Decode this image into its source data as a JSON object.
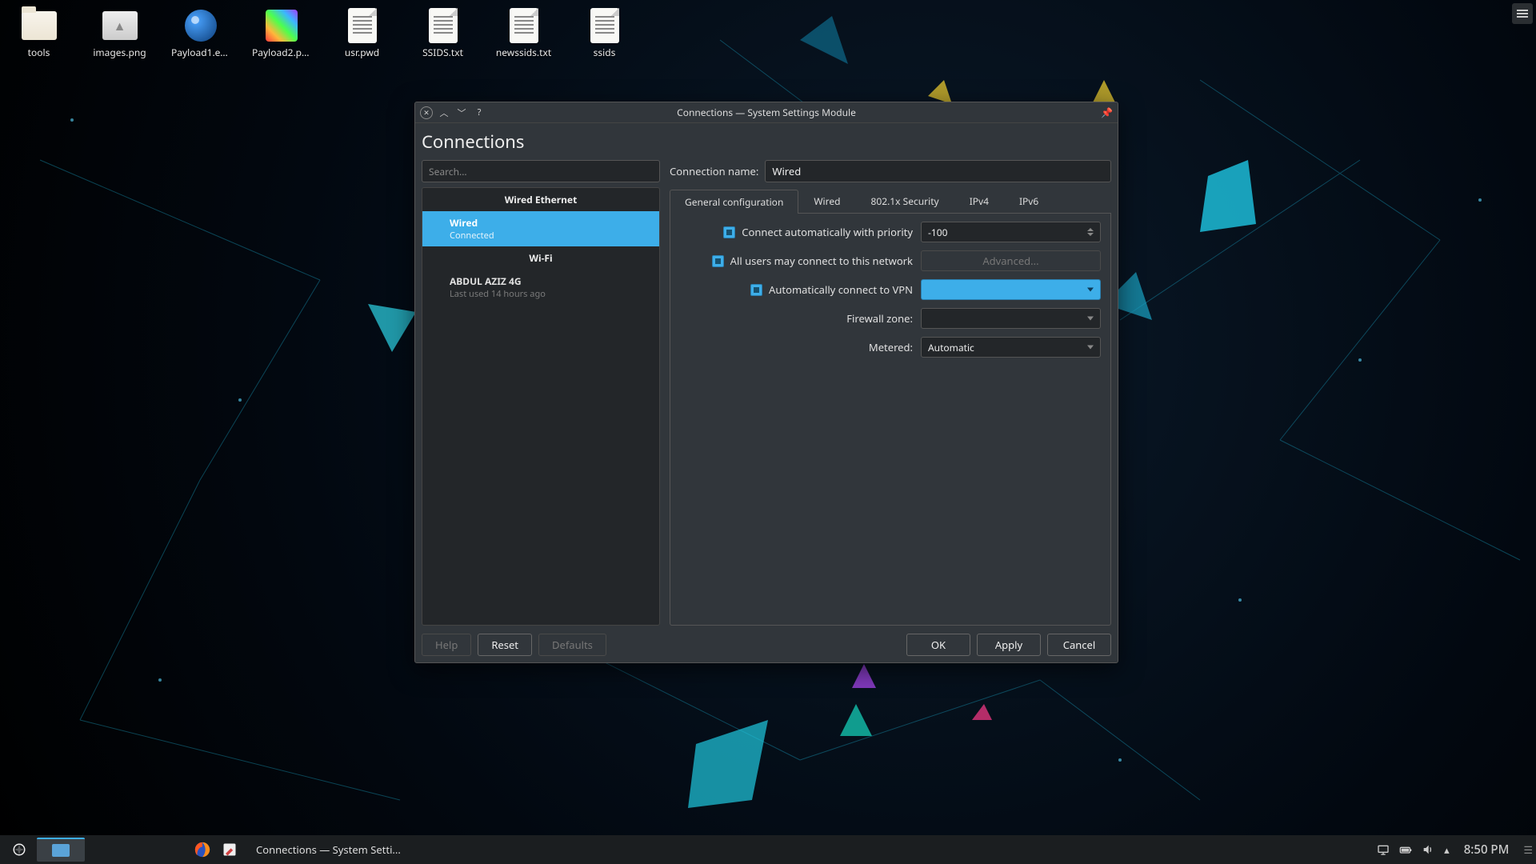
{
  "desktop_icons": [
    {
      "name": "tools",
      "type": "folder"
    },
    {
      "name": "images.png",
      "type": "img"
    },
    {
      "name": "Payload1.exe",
      "type": "exe"
    },
    {
      "name": "Payload2.png",
      "type": "png"
    },
    {
      "name": "usr.pwd",
      "type": "txt"
    },
    {
      "name": "SSIDS.txt",
      "type": "txt"
    },
    {
      "name": "newssids.txt",
      "type": "txt"
    },
    {
      "name": "ssids",
      "type": "txt"
    }
  ],
  "window": {
    "title": "Connections — System Settings Module",
    "heading": "Connections",
    "search_placeholder": "Search...",
    "groups": [
      {
        "label": "Wired Ethernet",
        "items": [
          {
            "name": "Wired",
            "status": "Connected",
            "selected": true
          }
        ]
      },
      {
        "label": "Wi-Fi",
        "items": [
          {
            "name": "ABDUL AZIZ 4G",
            "status": "Last used 14 hours ago",
            "selected": false
          }
        ]
      }
    ],
    "form": {
      "conn_name_label": "Connection name:",
      "conn_name_value": "Wired",
      "tabs": [
        "General configuration",
        "Wired",
        "802.1x Security",
        "IPv4",
        "IPv6"
      ],
      "active_tab": 0,
      "auto_priority_label": "Connect automatically with priority",
      "auto_priority_checked": true,
      "priority_value": "-100",
      "all_users_label": "All users may connect to this network",
      "all_users_checked": true,
      "advanced_label": "Advanced...",
      "auto_vpn_label": "Automatically connect to VPN",
      "auto_vpn_checked": true,
      "vpn_value": "",
      "firewall_label": "Firewall zone:",
      "firewall_value": "",
      "metered_label": "Metered:",
      "metered_value": "Automatic"
    },
    "buttons": {
      "help": "Help",
      "reset": "Reset",
      "defaults": "Defaults",
      "ok": "OK",
      "apply": "Apply",
      "cancel": "Cancel"
    }
  },
  "taskbar": {
    "task_label": "Connections — System Setti...",
    "clock": "8:50 PM"
  }
}
